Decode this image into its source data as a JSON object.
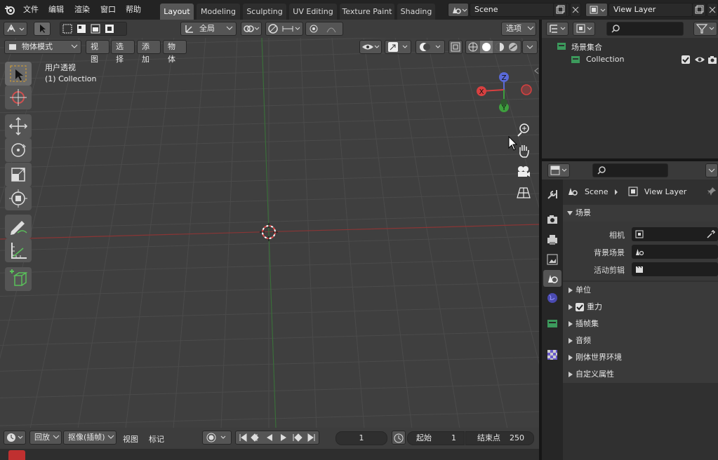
{
  "topbar": {
    "menus": [
      "文件",
      "编辑",
      "渲染",
      "窗口",
      "帮助"
    ],
    "workspaces": [
      "Layout",
      "Modeling",
      "Sculpting",
      "UV Editing",
      "Texture Paint",
      "Shading"
    ],
    "active_workspace": "Layout",
    "scene_name": "Scene",
    "view_layer_name": "View Layer"
  },
  "viewport_header": {
    "transform_orientation": "全局",
    "options_label": "选项"
  },
  "viewport_header2": {
    "mode": "物体模式",
    "menus": [
      "视图",
      "选择",
      "添加",
      "物体"
    ]
  },
  "viewport": {
    "view_name": "用户透视",
    "collection_label": "(1) Collection",
    "gizmo": {
      "x": "X",
      "y": "Y",
      "z": "Z"
    },
    "colors": {
      "bg": "#3f3f3f",
      "grid": "#4a4a4a",
      "x_axis": "#9a3a3a",
      "y_axis": "#3f7a3f"
    }
  },
  "timeline": {
    "playback_label": "回放",
    "keying_label": "抠像(插帧)",
    "view_label": "视图",
    "marker_label": "标记",
    "current_frame": "1",
    "start_label": "起始",
    "start_value": "1",
    "end_label": "结束点",
    "end_value": "250"
  },
  "outliner": {
    "root": "场景集合",
    "items": [
      {
        "name": "Collection"
      }
    ]
  },
  "properties": {
    "breadcrumb_scene": "Scene",
    "breadcrumb_layer": "View Layer",
    "panel_title": "场景",
    "fields": [
      {
        "label": "相机"
      },
      {
        "label": "背景场景"
      },
      {
        "label": "活动剪辑"
      }
    ],
    "sections": [
      "单位",
      "重力",
      "插帧集",
      "音频",
      "刚体世界环境",
      "自定义属性"
    ],
    "gravity_checked": true
  }
}
